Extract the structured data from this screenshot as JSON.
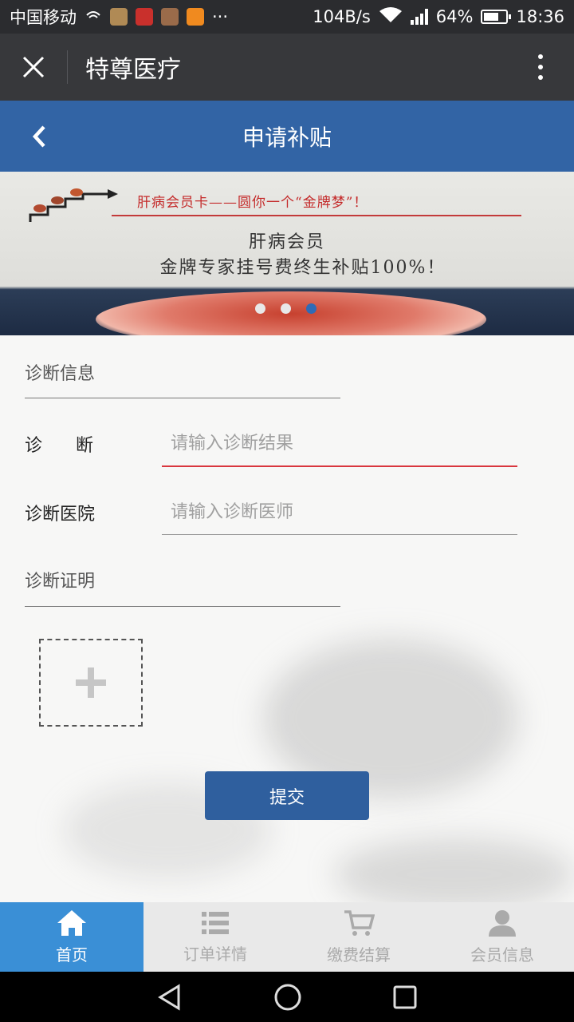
{
  "status_bar": {
    "carrier": "中国移动",
    "net_speed": "104B/s",
    "network_type": "4G",
    "battery": "64%",
    "battery_level": 0.64,
    "time": "18:36",
    "more_indicator": "···"
  },
  "title_bar": {
    "close_icon": "close-icon",
    "title": "特尊医疗",
    "more_icon": "more-vertical-icon"
  },
  "page_header": {
    "back_icon": "chevron-left-icon",
    "title": "申请补贴"
  },
  "banner": {
    "headline": "肝病会员卡——圆你一个“金牌梦”！",
    "line1": "肝病会员",
    "line2": "金牌专家挂号费终生补贴100%！",
    "slides": 3,
    "active_slide": 3
  },
  "form": {
    "section_diagnosis_info": "诊断信息",
    "diagnosis_label": "诊      断",
    "diagnosis_placeholder": "请输入诊断结果",
    "diagnosis_value": "",
    "hospital_label": "诊断医院",
    "hospital_placeholder": "请输入诊断医师",
    "hospital_value": "",
    "section_proof": "诊断证明",
    "upload_icon": "plus-icon",
    "submit_label": "提交"
  },
  "colors": {
    "header_blue": "#3264a5",
    "active_input_underline": "#d9363e",
    "tab_active": "#3a8fd6",
    "submit_blue": "#2f5f9e"
  },
  "tabs": [
    {
      "label": "首页",
      "icon": "home-icon",
      "active": true
    },
    {
      "label": "订单详情",
      "icon": "list-icon",
      "active": false
    },
    {
      "label": "缴费结算",
      "icon": "cart-icon",
      "active": false
    },
    {
      "label": "会员信息",
      "icon": "user-icon",
      "active": false
    }
  ],
  "nav_bar": {
    "back_icon": "triangle-back-icon",
    "home_icon": "circle-home-icon",
    "recents_icon": "square-recents-icon"
  }
}
